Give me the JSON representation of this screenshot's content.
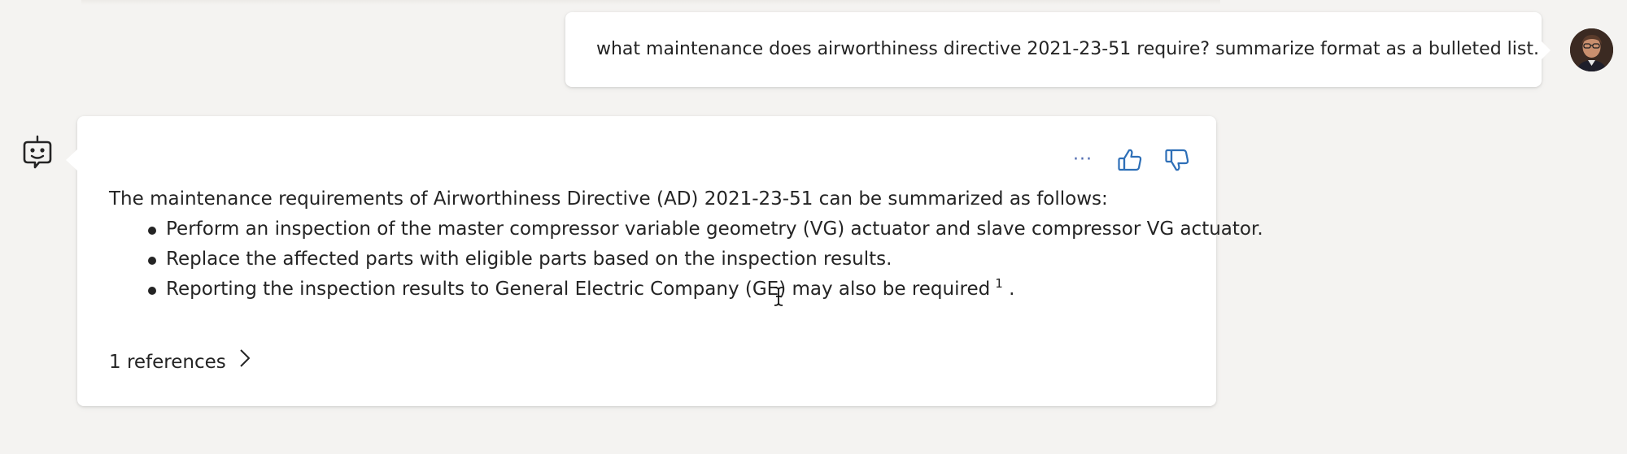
{
  "user_message": {
    "text": "what maintenance does airworthiness directive 2021-23-51 require? summarize format as a bulleted list."
  },
  "bot_message": {
    "intro": "The maintenance requirements of Airworthiness Directive (AD) 2021-23-51 can be summarized as follows:",
    "bullets": [
      "Perform an inspection of the master compressor variable geometry (VG) actuator and slave compressor VG actuator.",
      "Replace the affected parts with eligible parts based on the inspection results.",
      "Reporting the inspection results to General Electric Company (GE) may also be required"
    ],
    "citation": "1",
    "trailing": ".",
    "references_label": "1 references"
  },
  "icons": {
    "more": "more-options-icon",
    "like": "thumbs-up-icon",
    "dislike": "thumbs-down-icon",
    "bot": "bot-avatar-icon",
    "expand": "chevron-right-icon"
  },
  "colors": {
    "background": "#f4f3f1",
    "bubble": "#ffffff",
    "accent": "#2e6fb7",
    "text": "#242424"
  }
}
